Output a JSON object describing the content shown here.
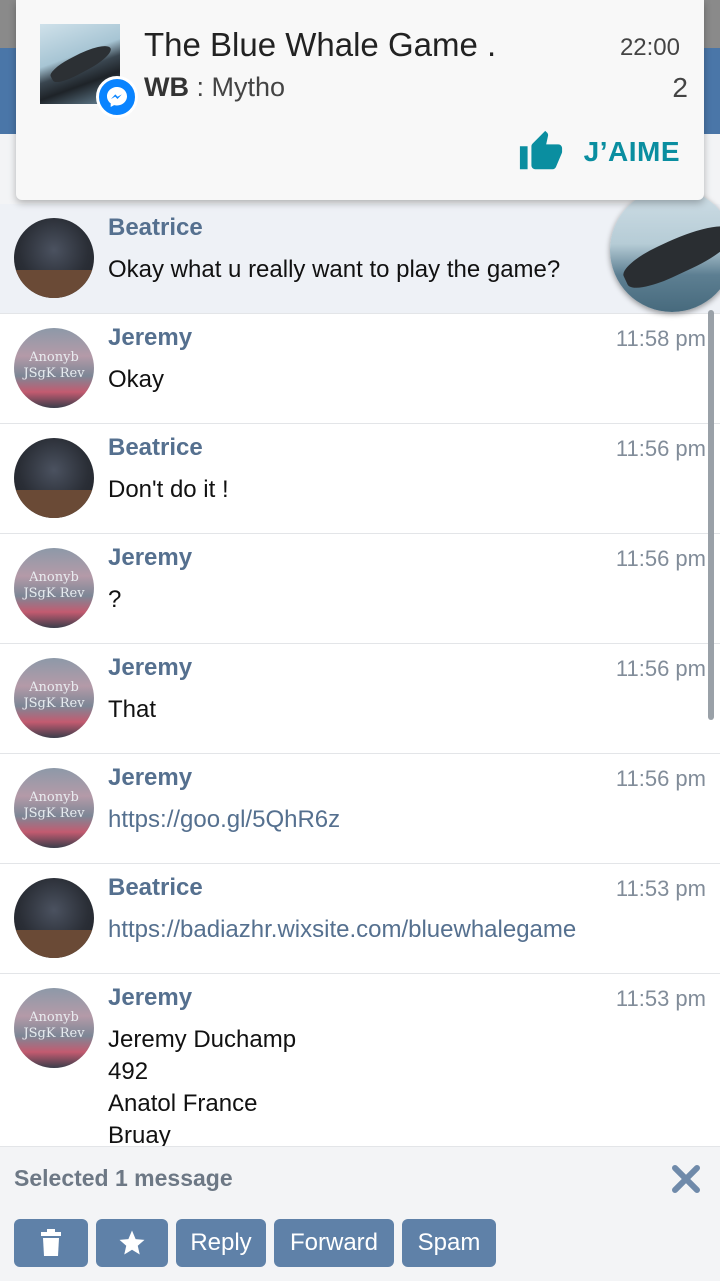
{
  "notification": {
    "title": "The Blue Whale Game .",
    "time": "22:00",
    "sender": "WB",
    "separator": " : ",
    "preview": "Mytho",
    "count": "2",
    "like_label": "J’AIME"
  },
  "messages": [
    {
      "name": "Beatrice",
      "time": "",
      "text": "Okay what u really want to play the game?",
      "avatar": "beatrice"
    },
    {
      "name": "Jeremy",
      "time": "11:58 pm",
      "text": "Okay",
      "avatar": "jeremy"
    },
    {
      "name": "Beatrice",
      "time": "11:56 pm",
      "text": "Don't do it !",
      "avatar": "beatrice"
    },
    {
      "name": "Jeremy",
      "time": "11:56 pm",
      "text": "?",
      "avatar": "jeremy"
    },
    {
      "name": "Jeremy",
      "time": "11:56 pm",
      "text": "That",
      "avatar": "jeremy"
    },
    {
      "name": "Jeremy",
      "time": "11:56 pm",
      "text": "https://goo.gl/5QhR6z",
      "avatar": "jeremy"
    },
    {
      "name": "Beatrice",
      "time": "11:53 pm",
      "text": "https://badiazhr.wixsite.com/bluewhalegame",
      "avatar": "beatrice"
    },
    {
      "name": "Jeremy",
      "time": "11:53 pm",
      "text": "Jeremy Duchamp",
      "avatar": "jeremy",
      "extra_lines": [
        "492",
        "Anatol France",
        "Bruay"
      ]
    }
  ],
  "avatar_text": {
    "jeremy_line1": "Anonyb",
    "jeremy_line2": "JSgK Rev"
  },
  "action_bar": {
    "selected_label": "Selected 1 message",
    "reply": "Reply",
    "forward": "Forward",
    "spam": "Spam"
  },
  "icons": [
    "messenger-icon",
    "thumbs-up-icon",
    "close-icon",
    "trash-icon",
    "star-icon"
  ],
  "colors": {
    "accent": "#4a76a8",
    "name_text": "#55708f",
    "button_bg": "#5f81a8",
    "like_teal": "#0a8ea0",
    "messenger_blue": "#0a84ff"
  }
}
